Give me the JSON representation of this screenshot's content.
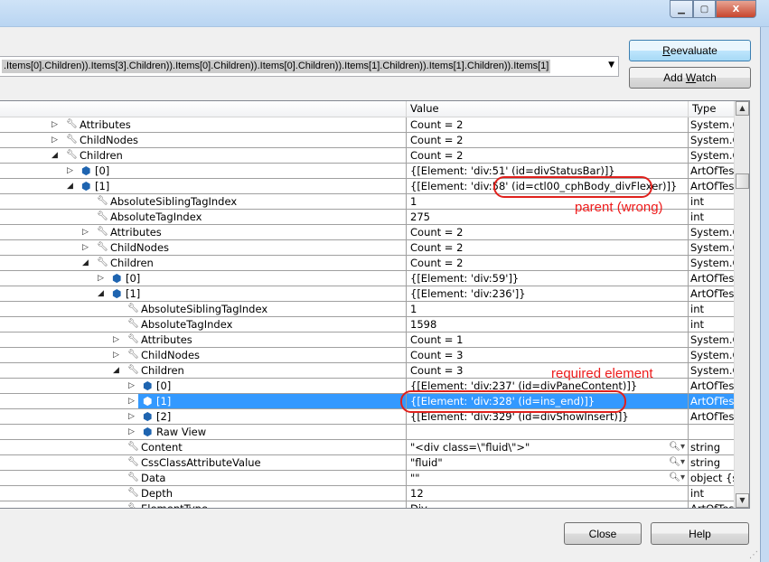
{
  "window": {
    "minimize_icon": "minimize-icon",
    "maximize_icon": "maximize-icon",
    "close_icon": "close-icon"
  },
  "expression": {
    "value": ".Items[0].Children)).Items[3].Children)).Items[0].Children)).Items[0].Children)).Items[1].Children)).Items[1].Children)).Items[1]"
  },
  "buttons": {
    "reevaluate_pre": "",
    "reevaluate_u": "R",
    "reevaluate_post": "eevaluate",
    "addwatch_pre": "Add ",
    "addwatch_u": "W",
    "addwatch_post": "atch",
    "close": "Close",
    "help": "Help"
  },
  "grid": {
    "headers": {
      "name": "",
      "value": "Value",
      "type": "Type"
    },
    "rows": [
      {
        "level": 0,
        "expander": "collapsed",
        "icon": "wrench",
        "name": "Attributes",
        "value": "Count = 2",
        "type": "System.C"
      },
      {
        "level": 0,
        "expander": "collapsed",
        "icon": "wrench",
        "name": "ChildNodes",
        "value": "Count = 2",
        "type": "System.C"
      },
      {
        "level": 0,
        "expander": "expanded",
        "icon": "wrench",
        "name": "Children",
        "value": "Count = 2",
        "type": "System.C"
      },
      {
        "level": 1,
        "expander": "collapsed",
        "icon": "cube",
        "name": "[0]",
        "value": "{[Element: 'div:51' (id=divStatusBar)]}",
        "type": "ArtOfTes"
      },
      {
        "level": 1,
        "expander": "expanded",
        "icon": "cube",
        "name": "[1]",
        "value": "{[Element: 'div:58' (id=ctl00_cphBody_divFlexer)]}",
        "type": "ArtOfTes"
      },
      {
        "level": 2,
        "expander": "none",
        "icon": "wrench",
        "name": "AbsoluteSiblingTagIndex",
        "value": "1",
        "type": "int"
      },
      {
        "level": 2,
        "expander": "none",
        "icon": "wrench",
        "name": "AbsoluteTagIndex",
        "value": "275",
        "type": "int"
      },
      {
        "level": 2,
        "expander": "collapsed",
        "icon": "wrench",
        "name": "Attributes",
        "value": "Count = 2",
        "type": "System.C"
      },
      {
        "level": 2,
        "expander": "collapsed",
        "icon": "wrench",
        "name": "ChildNodes",
        "value": "Count = 2",
        "type": "System.C"
      },
      {
        "level": 2,
        "expander": "expanded",
        "icon": "wrench",
        "name": "Children",
        "value": "Count = 2",
        "type": "System.C"
      },
      {
        "level": 3,
        "expander": "collapsed",
        "icon": "cube",
        "name": "[0]",
        "value": "{[Element: 'div:59']}",
        "type": "ArtOfTes"
      },
      {
        "level": 3,
        "expander": "expanded",
        "icon": "cube",
        "name": "[1]",
        "value": "{[Element: 'div:236']}",
        "type": "ArtOfTes"
      },
      {
        "level": 4,
        "expander": "none",
        "icon": "wrench",
        "name": "AbsoluteSiblingTagIndex",
        "value": "1",
        "type": "int"
      },
      {
        "level": 4,
        "expander": "none",
        "icon": "wrench",
        "name": "AbsoluteTagIndex",
        "value": "1598",
        "type": "int"
      },
      {
        "level": 4,
        "expander": "collapsed",
        "icon": "wrench",
        "name": "Attributes",
        "value": "Count = 1",
        "type": "System.C"
      },
      {
        "level": 4,
        "expander": "collapsed",
        "icon": "wrench",
        "name": "ChildNodes",
        "value": "Count = 3",
        "type": "System.C"
      },
      {
        "level": 4,
        "expander": "expanded",
        "icon": "wrench",
        "name": "Children",
        "value": "Count = 3",
        "type": "System.C"
      },
      {
        "level": 5,
        "expander": "collapsed",
        "icon": "cube",
        "name": "[0]",
        "value": "{[Element: 'div:237' (id=divPaneContent)]}",
        "type": "ArtOfTes"
      },
      {
        "level": 5,
        "expander": "collapsed",
        "icon": "cube",
        "name": "[1]",
        "value": "{[Element: 'div:328' (id=ins_end)]}",
        "type": "ArtOfTes",
        "selected": true
      },
      {
        "level": 5,
        "expander": "collapsed",
        "icon": "cube",
        "name": "[2]",
        "value": "{[Element: 'div:329' (id=divShowInsert)]}",
        "type": "ArtOfTes"
      },
      {
        "level": 5,
        "expander": "collapsed",
        "icon": "cube",
        "name": "Raw View",
        "value": "",
        "type": ""
      },
      {
        "level": 4,
        "expander": "none",
        "icon": "wrench",
        "name": "Content",
        "value": "\"<div class=\\\"fluid\\\">\"",
        "type": "string",
        "visualizer": true
      },
      {
        "level": 4,
        "expander": "none",
        "icon": "wrench",
        "name": "CssClassAttributeValue",
        "value": "\"fluid\"",
        "type": "string",
        "visualizer": true
      },
      {
        "level": 4,
        "expander": "none",
        "icon": "wrench",
        "name": "Data",
        "value": "\"\"",
        "type": "object {s",
        "visualizer": true
      },
      {
        "level": 4,
        "expander": "none",
        "icon": "wrench",
        "name": "Depth",
        "value": "12",
        "type": "int"
      },
      {
        "level": 4,
        "expander": "none",
        "icon": "wrench",
        "name": "ElementType",
        "value": "Div",
        "type": "ArtOfTes"
      }
    ]
  },
  "annotations": {
    "parent": "parent (wrong)",
    "required": "required element",
    "color": "#ee1c1c"
  },
  "colors": {
    "selection": "#3399ff",
    "titlebar": "#b9d5f2"
  }
}
